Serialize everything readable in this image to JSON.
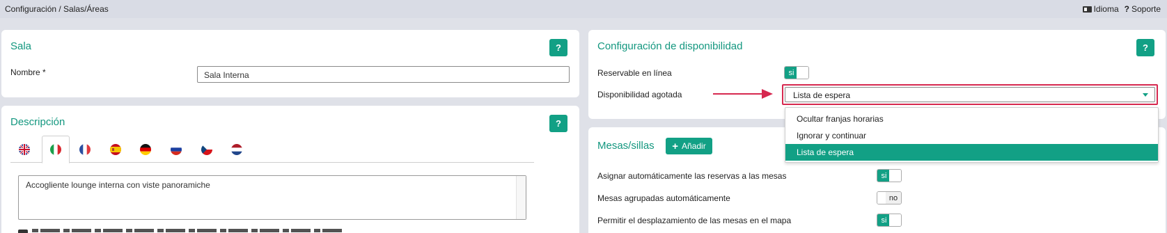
{
  "topbar": {
    "breadcrumb": "Configuración / Salas/Áreas",
    "language_label": "Idioma",
    "support_label": "Soporte"
  },
  "sala": {
    "title": "Sala",
    "help_label": "?",
    "name_label": "Nombre *",
    "name_value": "Sala Interna"
  },
  "descripcion": {
    "title": "Descripción",
    "help_label": "?",
    "flags": [
      "uk-flag-icon",
      "italy-flag-icon",
      "france-flag-icon",
      "spain-flag-icon",
      "germany-flag-icon",
      "russia-flag-icon",
      "czech-flag-icon",
      "netherlands-flag-icon"
    ],
    "active_flag": "italy-flag-icon",
    "text_value": "Accogliente lounge interna con viste panoramiche"
  },
  "disponibilidad": {
    "title": "Configuración de disponibilidad",
    "help_label": "?",
    "reservable_label": "Reservable en línea",
    "reservable_toggle": "si",
    "agotada_label": "Disponibilidad agotada",
    "agotada_value": "Lista de espera",
    "options": [
      "Ocultar franjas horarias",
      "Ignorar y continuar",
      "Lista de espera"
    ],
    "selected_option_index": 2
  },
  "mesas": {
    "title": "Mesas/sillas",
    "add_label": "Añadir",
    "rows": [
      {
        "label": "Asignar automáticamente las reservas a las mesas",
        "toggle": "si"
      },
      {
        "label": "Mesas agrupadas automáticamente",
        "toggle": "no"
      },
      {
        "label": "Permitir el desplazamiento de las mesas en el mapa",
        "toggle": "si"
      }
    ]
  },
  "colors": {
    "accent": "#12a085",
    "highlight": "#d6284f",
    "background": "#dfe1e8"
  }
}
